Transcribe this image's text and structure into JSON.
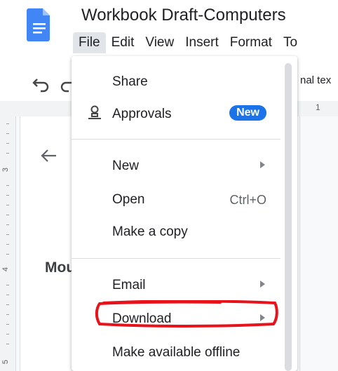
{
  "app": {
    "title": "Workbook Draft-Computers",
    "icon": "google-docs-icon",
    "accent_color": "#4285f4"
  },
  "menubar": {
    "items": [
      {
        "label": "File",
        "active": true
      },
      {
        "label": "Edit"
      },
      {
        "label": "View"
      },
      {
        "label": "Insert"
      },
      {
        "label": "Format"
      },
      {
        "label": "To"
      }
    ]
  },
  "toolbar": {
    "undo_icon": "undo-icon",
    "redo_icon": "redo-icon",
    "style_partial": "nal tex"
  },
  "ruler": {
    "top_number": "1",
    "left_numbers": [
      "3",
      "4",
      "5"
    ]
  },
  "document": {
    "heading_fragment": "Mou",
    "back_icon": "arrow-left-icon"
  },
  "file_menu": {
    "share": "Share",
    "approvals": {
      "label": "Approvals",
      "badge": "New",
      "icon": "approvals-icon",
      "badge_color": "#1a73e8"
    },
    "new": "New",
    "open": {
      "label": "Open",
      "shortcut": "Ctrl+O"
    },
    "make_copy": "Make a copy",
    "email": "Email",
    "download": "Download",
    "offline": "Make available offline"
  },
  "annotation": {
    "highlight_color": "#e8131a",
    "target": "Download"
  }
}
